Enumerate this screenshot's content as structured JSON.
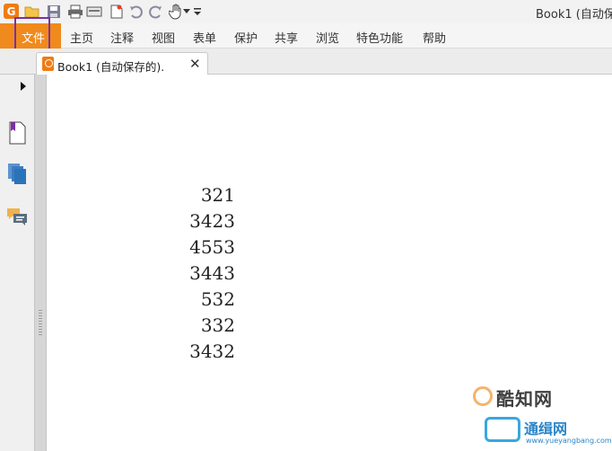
{
  "quick_access": {
    "app_icon_glyph": "G",
    "title": "Book1 (自动保"
  },
  "ribbon": {
    "file": "文件",
    "items": [
      "主页",
      "注释",
      "视图",
      "表单",
      "保护",
      "共享",
      "浏览",
      "特色功能",
      "帮助"
    ]
  },
  "tab": {
    "label": "Book1 (自动保存的).",
    "close": "✕"
  },
  "document": {
    "numbers": [
      "321",
      "3423",
      "4553",
      "3443",
      "532",
      "332",
      "3432"
    ]
  },
  "watermarks": {
    "primary": "酷知网",
    "secondary": "通缉网",
    "secondary_url": "www.yueyangbang.com"
  },
  "colors": {
    "accent": "#f08a1c",
    "highlight_box": "#7b2fa8",
    "nav_icon_blue": "#2b73b8"
  },
  "icons": [
    "app-logo-icon",
    "open-folder-icon",
    "save-icon",
    "print-icon",
    "scan-icon",
    "new-document-icon",
    "undo-icon",
    "redo-icon",
    "hand-tool-icon",
    "dropdown-arrow-icon",
    "customize-icon",
    "pdf-tab-icon",
    "close-icon",
    "expand-arrow-icon",
    "bookmark-icon",
    "pages-icon",
    "comments-icon"
  ]
}
